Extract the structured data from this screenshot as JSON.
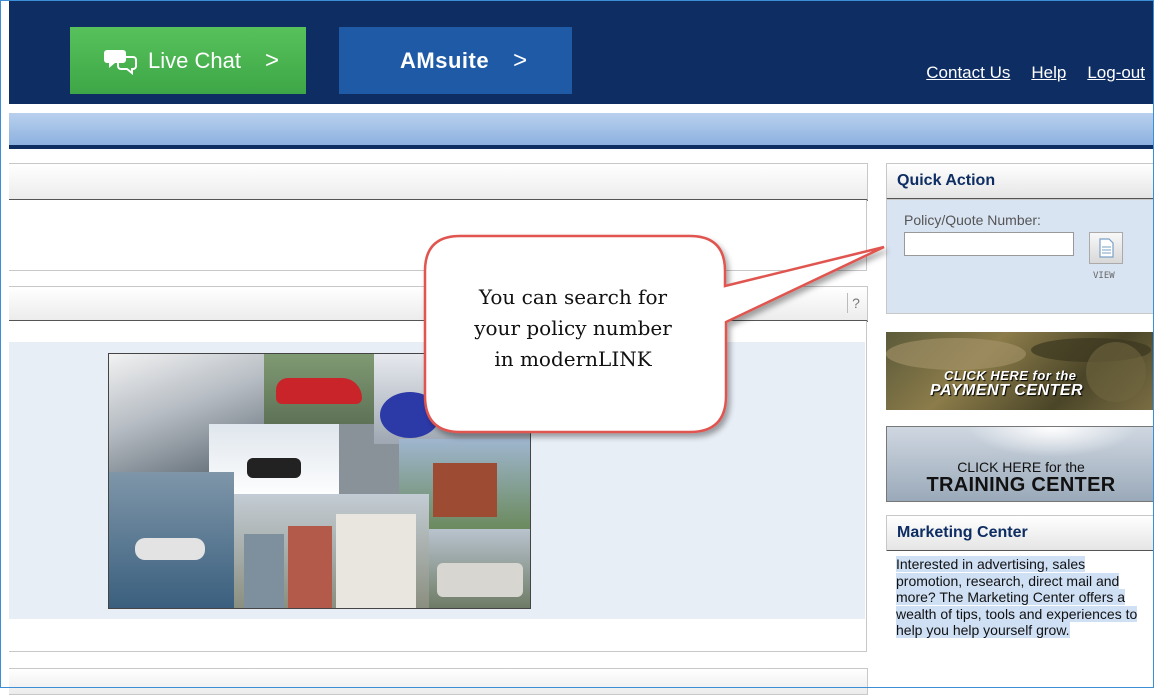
{
  "header": {
    "live_chat_label": "Live Chat",
    "live_chat_chevron": ">",
    "amsuite_label": "AMsuite",
    "amsuite_chevron": ">",
    "links": [
      "Contact Us",
      "Help",
      "Log-out"
    ]
  },
  "panel": {
    "help_label": "?"
  },
  "quick_action": {
    "title": "Quick Action",
    "field_label": "Policy/Quote Number:",
    "field_value": "",
    "view_label": "VIEW"
  },
  "banners": {
    "payment_line1": "CLICK HERE for the",
    "payment_line2": "PAYMENT CENTER",
    "training_line1": "CLICK HERE for the",
    "training_line2": "TRAINING CENTER"
  },
  "marketing": {
    "title": "Marketing Center",
    "body": "Interested in advertising, sales promotion, research, direct mail and more? The Marketing Center offers a wealth of tips, tools and experiences to help you help yourself grow."
  },
  "callout": {
    "lines": [
      "You can search for",
      "your policy number",
      "in modernLINK"
    ]
  },
  "colors": {
    "header_navy": "#0d2d63",
    "live_chat_green": "#4cb452",
    "amsuite_blue": "#1f5aa6",
    "subnav_blue": "#a7c3e7",
    "callout_border": "#e0554f"
  }
}
